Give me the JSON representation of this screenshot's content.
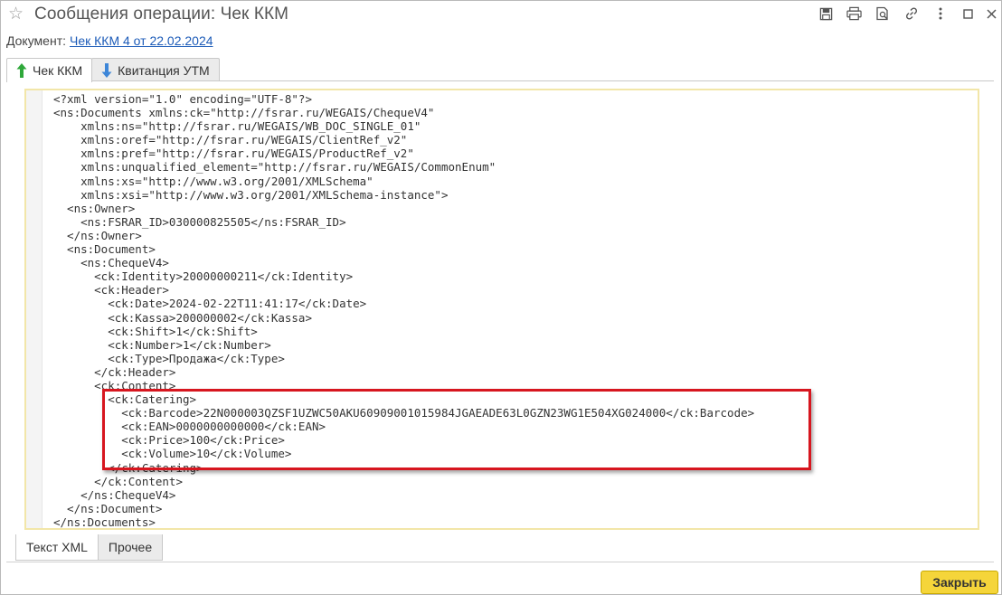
{
  "window": {
    "title": "Сообщения операции: Чек ККМ"
  },
  "document": {
    "label": "Документ:",
    "link": "Чек ККМ 4 от 22.02.2024"
  },
  "tabs_top": [
    {
      "label": "Чек ККМ",
      "icon": "arrow-up-green-icon"
    },
    {
      "label": "Квитанция УТМ",
      "icon": "arrow-down-blue-icon"
    }
  ],
  "xml_lines": [
    "<?xml version=\"1.0\" encoding=\"UTF-8\"?>",
    "<ns:Documents xmlns:ck=\"http://fsrar.ru/WEGAIS/ChequeV4\"",
    "    xmlns:ns=\"http://fsrar.ru/WEGAIS/WB_DOC_SINGLE_01\"",
    "    xmlns:oref=\"http://fsrar.ru/WEGAIS/ClientRef_v2\"",
    "    xmlns:pref=\"http://fsrar.ru/WEGAIS/ProductRef_v2\"",
    "    xmlns:unqualified_element=\"http://fsrar.ru/WEGAIS/CommonEnum\"",
    "    xmlns:xs=\"http://www.w3.org/2001/XMLSchema\"",
    "    xmlns:xsi=\"http://www.w3.org/2001/XMLSchema-instance\">",
    "  <ns:Owner>",
    "    <ns:FSRAR_ID>030000825505</ns:FSRAR_ID>",
    "  </ns:Owner>",
    "  <ns:Document>",
    "    <ns:ChequeV4>",
    "      <ck:Identity>20000000211</ck:Identity>",
    "      <ck:Header>",
    "        <ck:Date>2024-02-22T11:41:17</ck:Date>",
    "        <ck:Kassa>200000002</ck:Kassa>",
    "        <ck:Shift>1</ck:Shift>",
    "        <ck:Number>1</ck:Number>",
    "        <ck:Type>Продажа</ck:Type>",
    "      </ck:Header>",
    "      <ck:Content>",
    "        <ck:Catering>",
    "          <ck:Barcode>22N000003QZSF1UZWC50AKU60909001015984JGAEADE63L0GZN23WG1E504XG024000</ck:Barcode>",
    "          <ck:EAN>0000000000000</ck:EAN>",
    "          <ck:Price>100</ck:Price>",
    "          <ck:Volume>10</ck:Volume>",
    "        </ck:Catering>",
    "      </ck:Content>",
    "    </ns:ChequeV4>",
    "  </ns:Document>",
    "</ns:Documents>"
  ],
  "tabs_bottom": [
    {
      "label": "Текст XML"
    },
    {
      "label": "Прочее"
    }
  ],
  "buttons": {
    "close": "Закрыть"
  },
  "colors": {
    "accent_yellow": "#f5d53a",
    "highlight_red": "#d7161f",
    "link_blue": "#1c5bb8"
  }
}
